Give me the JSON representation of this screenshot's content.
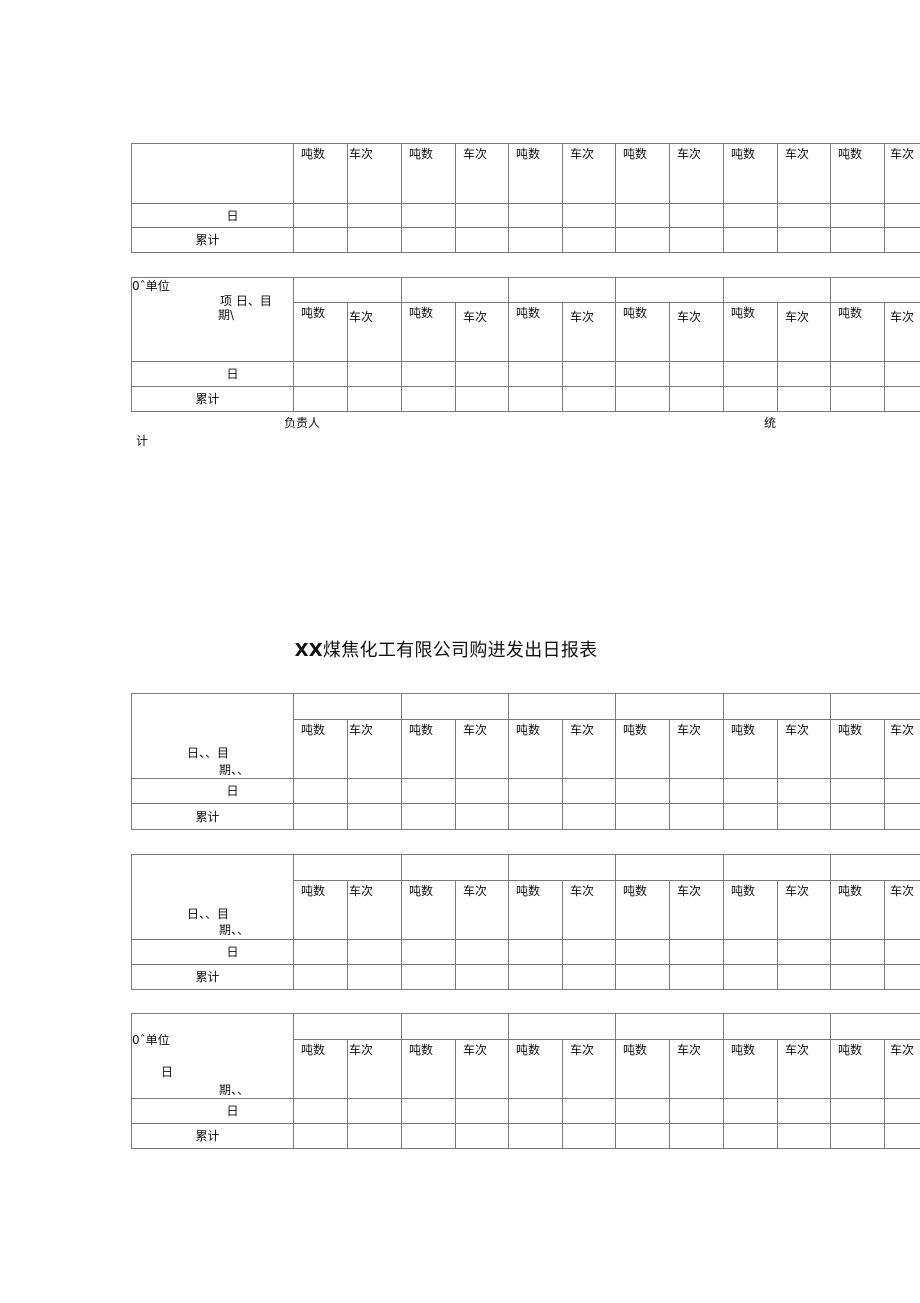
{
  "document": {
    "title_prefix": "XX",
    "title_main": "煤焦化工有限公司购进发出日报表",
    "column_headers": {
      "tons": "吨数",
      "trips": "车次"
    },
    "row_labels": {
      "day": "日",
      "cumulative": "累计"
    },
    "tables": [
      {
        "id": "table-1",
        "corner": []
      },
      {
        "id": "table-2",
        "corner": [
          "0ˆ单位",
          "项 日、目",
          "期\\"
        ]
      },
      {
        "id": "table-3",
        "corner": [
          "日、、目",
          "期、、"
        ]
      },
      {
        "id": "table-4",
        "corner": [
          "日、、目",
          "期、、"
        ]
      },
      {
        "id": "table-5",
        "corner": [
          "0ˆ单位",
          "日",
          "期、、"
        ]
      }
    ],
    "footer": {
      "responsible": "负责人",
      "statistics_1": "统",
      "statistics_2": "计"
    }
  }
}
